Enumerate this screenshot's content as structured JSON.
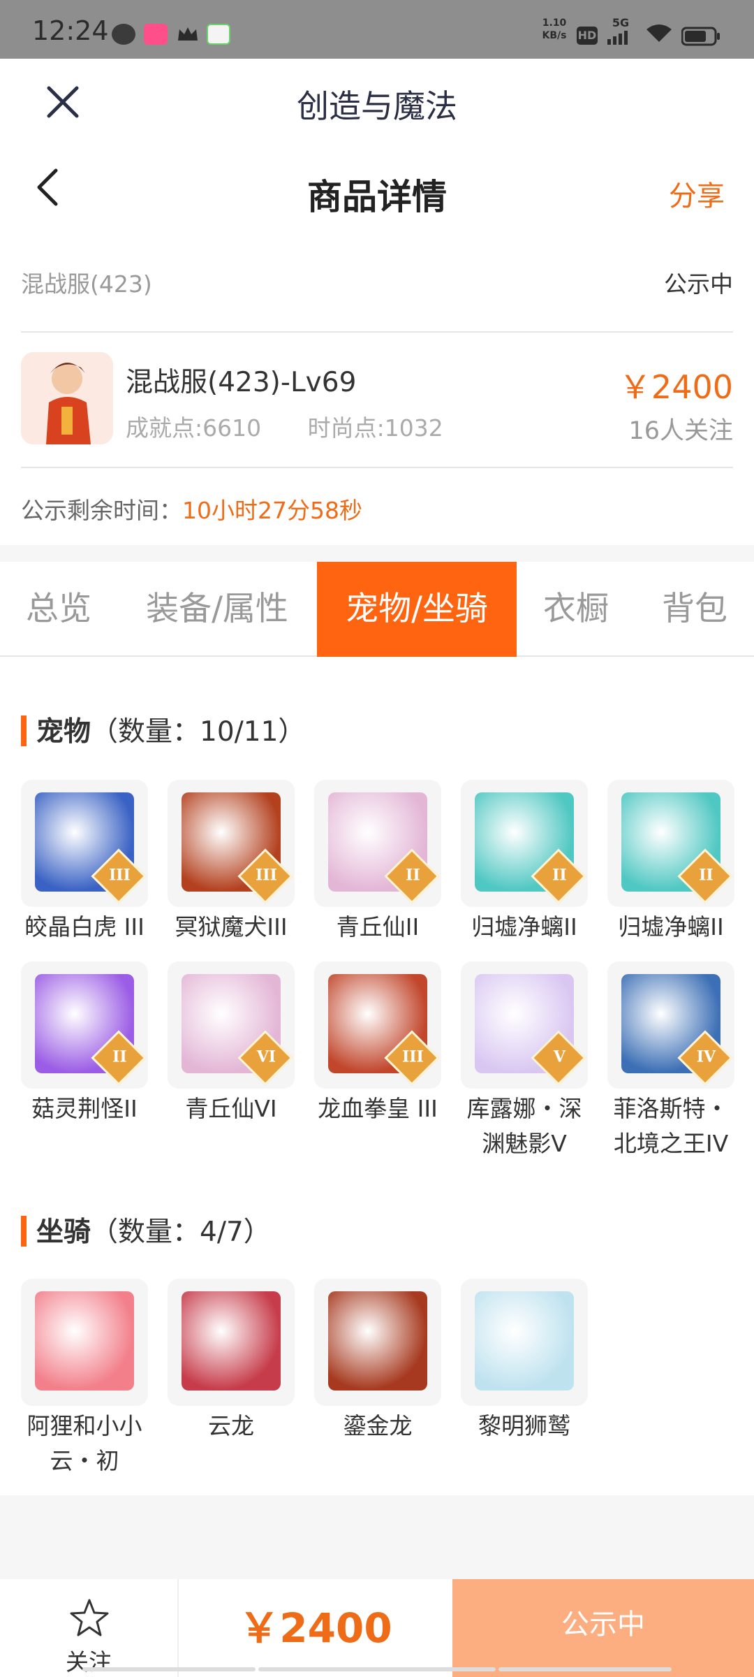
{
  "status_bar": {
    "time": "12:24",
    "net_speed": "1.10\nKB/s",
    "hd": "HD",
    "signal": "5G"
  },
  "titlebar": {
    "close_icon": "close-icon",
    "app_title": "创造与魔法"
  },
  "header": {
    "back_icon": "chevron-left-icon",
    "title": "商品详情",
    "share_label": "分享"
  },
  "server": {
    "name": "混战服(423)",
    "status": "公示中"
  },
  "item": {
    "name": "混战服(423)-Lv69",
    "achievement": "成就点:6610",
    "fashion": "时尚点:1032",
    "price": "￥2400",
    "followers": "16人关注"
  },
  "timer": {
    "label": "公示剩余时间：",
    "value": "10小时27分58秒"
  },
  "tabs": [
    {
      "label": "总览",
      "active": false
    },
    {
      "label": "装备/属性",
      "active": false
    },
    {
      "label": "宠物/坐骑",
      "active": true
    },
    {
      "label": "衣橱",
      "active": false
    },
    {
      "label": "背包",
      "active": false
    }
  ],
  "pets_section": {
    "title": "宠物",
    "count": "（数量：10/11）"
  },
  "pets": [
    {
      "name": "皎晶白虎 III",
      "tier": "III",
      "color": "#3a62c4"
    },
    {
      "name": "冥狱魔犬III",
      "tier": "III",
      "color": "#b3411f"
    },
    {
      "name": "青丘仙II",
      "tier": "II",
      "color": "#e3b6d6"
    },
    {
      "name": "归墟净螭II",
      "tier": "II",
      "color": "#4fc7c2"
    },
    {
      "name": "归墟净螭II",
      "tier": "II",
      "color": "#4fc7c2"
    },
    {
      "name": "菇灵荆怪II",
      "tier": "II",
      "color": "#9b5de5"
    },
    {
      "name": "青丘仙VI",
      "tier": "VI",
      "color": "#e3b6d6"
    },
    {
      "name": "龙血拳皇 III",
      "tier": "III",
      "color": "#c1462c"
    },
    {
      "name": "库露娜・深渊魅影V",
      "tier": "V",
      "color": "#d9c7f2"
    },
    {
      "name": "菲洛斯特・北境之王IV",
      "tier": "IV",
      "color": "#3c6fb5"
    }
  ],
  "mounts_section": {
    "title": "坐骑",
    "count": "（数量：4/7）"
  },
  "mounts": [
    {
      "name": "阿狸和小小云・初",
      "color": "#f27f8a"
    },
    {
      "name": "云龙",
      "color": "#c63c4a"
    },
    {
      "name": "鎏金龙",
      "color": "#a6391f"
    },
    {
      "name": "黎明狮鹫",
      "color": "#bfe2ef"
    }
  ],
  "bottom_bar": {
    "follow_label": "关注",
    "price": "￥2400",
    "status_label": "公示中"
  }
}
